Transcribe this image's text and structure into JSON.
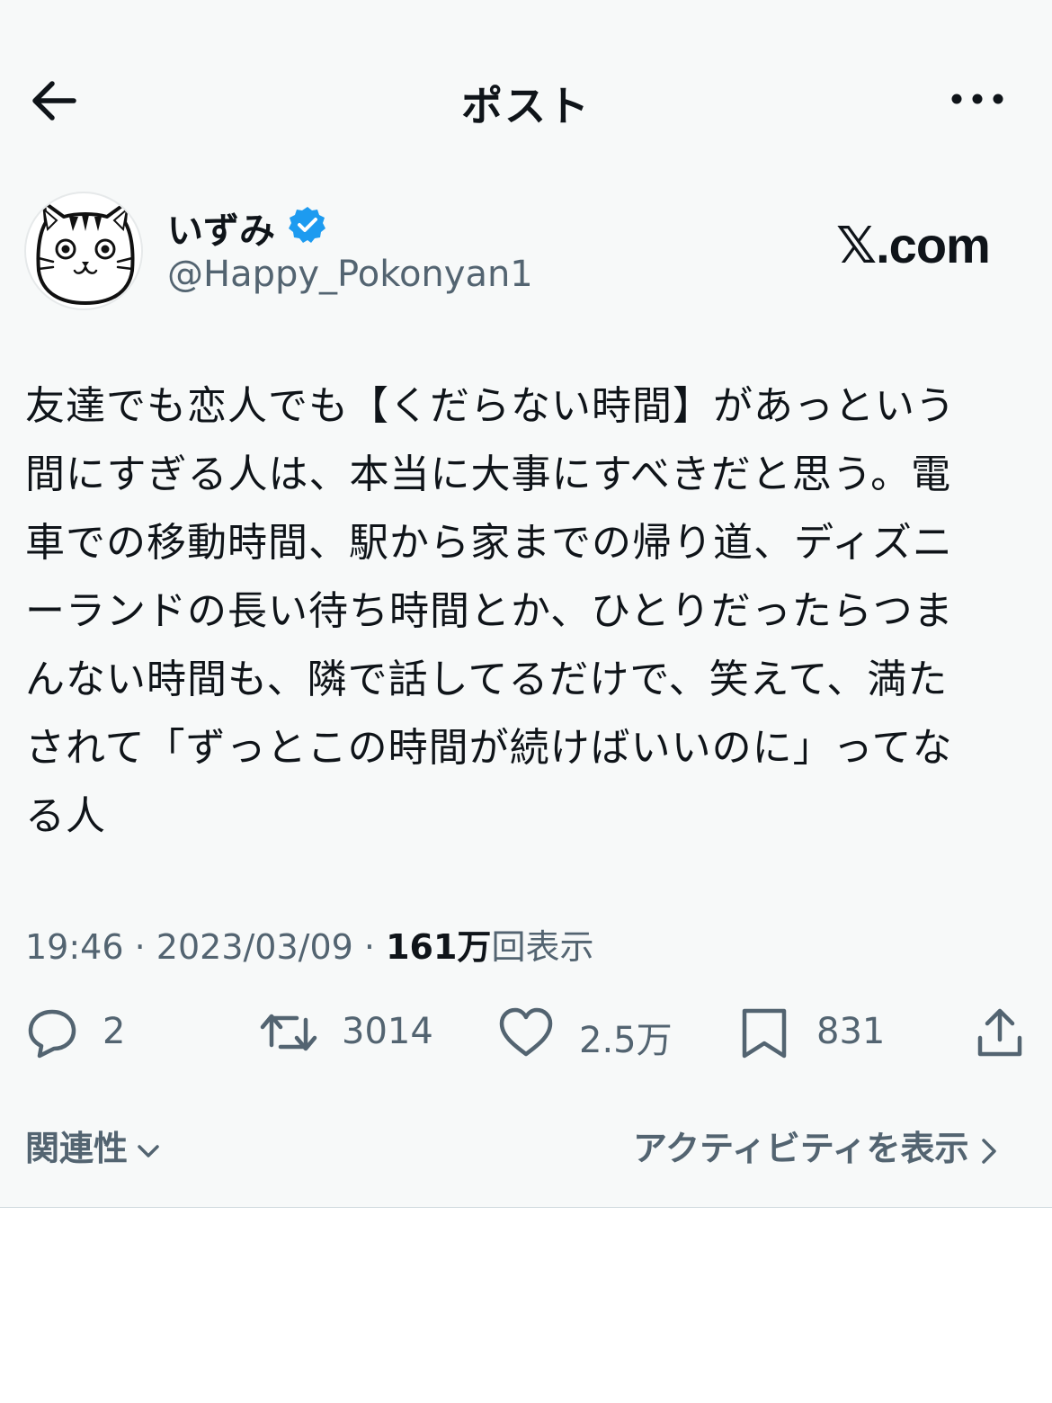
{
  "header": {
    "title": "ポスト"
  },
  "author": {
    "name": "いずみ",
    "handle": "@Happy_Pokonyan1",
    "verified": true
  },
  "brand": "𝕏.com",
  "tweet": {
    "lines": [
      "友達でも恋人でも【くだらない時間】があっという",
      "間にすぎる人は、本当に大事にすべきだと思う。電",
      "車での移動時間、駅から家までの帰り道、ディズニ",
      "ーランドの長い待ち時間とか、ひとりだったらつま",
      "んない時間も、隣で話してるだけで、笑えて、満た",
      "されて「ずっとこの時間が続けばいいのに」ってな",
      "る人"
    ]
  },
  "meta": {
    "time": "19:46",
    "separator": "·",
    "date": "2023/03/09",
    "views_count": "161万",
    "views_label": "回表示"
  },
  "actions": {
    "replies": "2",
    "retweets": "3014",
    "likes": "2.5万",
    "bookmarks": "831"
  },
  "footer": {
    "relevance_label": "関連性",
    "activity_label": "アクティビティを表示"
  },
  "colors": {
    "background": "#f7f9f9",
    "text_primary": "#0f1419",
    "text_secondary": "#536471",
    "verified_blue": "#1d9bf0"
  },
  "icons": [
    "back-arrow-icon",
    "more-icon",
    "verified-badge-icon",
    "reply-icon",
    "retweet-icon",
    "like-icon",
    "bookmark-icon",
    "share-icon",
    "chevron-down-icon",
    "chevron-right-icon"
  ]
}
